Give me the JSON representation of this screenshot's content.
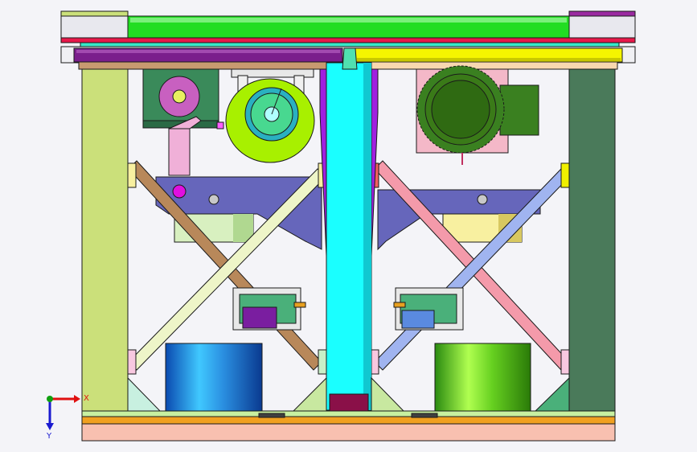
{
  "triad": {
    "x_label": "X",
    "y_label": "Y",
    "x_color": "#e01010",
    "y_color": "#1a1ad0",
    "origin_color": "#10a010"
  },
  "colors": {
    "background": "#f4f4f8",
    "outline": "#1a1a1a",
    "top_plate": "#22dd22",
    "red_bar": "#e8184a",
    "purple_beam": "#7a1e8c",
    "yellow_beam": "#f5f500",
    "left_column": "#cbe07a",
    "right_column": "#4a7a5a",
    "center_column": "#1affff",
    "cross_plate": "#6666bb",
    "brace_brown": "#b8885a",
    "brace_cream": "#eef5c8",
    "brace_pink": "#f49aaa",
    "brace_blue": "#a0b4f0",
    "drum_blue": "#2a8ee0",
    "drum_green": "#66d020",
    "base_orange": "#f0a020",
    "base_pink": "#f8c0b0",
    "motor_dark": "#3a8020",
    "pulley_green": "#a8f000",
    "pulley_inner": "#48d890"
  }
}
